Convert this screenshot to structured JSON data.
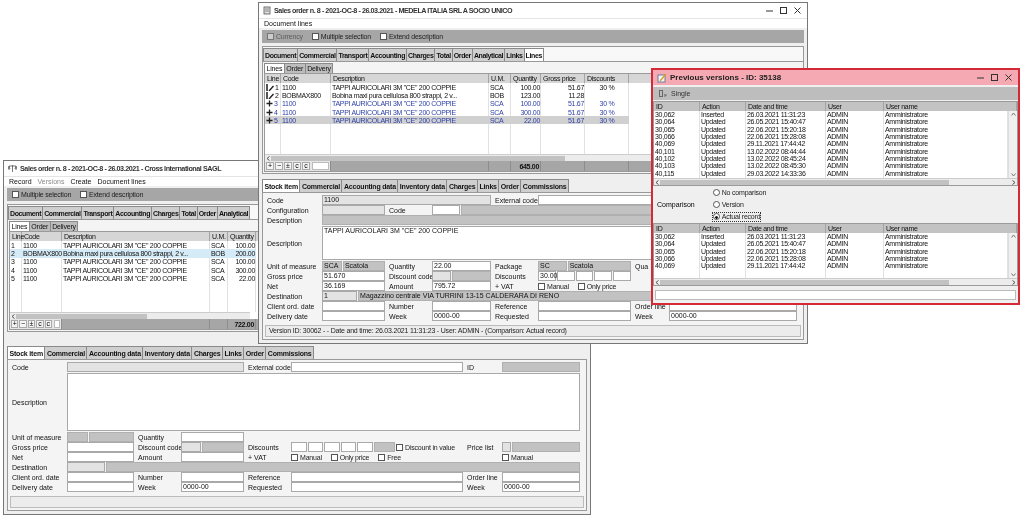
{
  "windows": [
    {
      "kind": "order",
      "title": "Sales order n. 8 - 2021-OC-8 - 26.03.2021 - Cross International SAGL",
      "menu": [
        {
          "label": "Record",
          "disabled": false
        },
        {
          "label": "Versions",
          "disabled": true
        },
        {
          "label": "Create",
          "disabled": false
        },
        {
          "label": "Document lines",
          "disabled": false
        }
      ],
      "options": [
        {
          "label": "Multiple selection",
          "checked": false,
          "disabled": false
        },
        {
          "label": "Extend description",
          "checked": false,
          "disabled": false
        }
      ],
      "tabs": [
        {
          "label": "Document",
          "selected": false
        },
        {
          "label": "Commercial",
          "selected": false
        },
        {
          "label": "Transport",
          "selected": false
        },
        {
          "label": "Accounting",
          "selected": false
        },
        {
          "label": "Charges",
          "selected": false
        },
        {
          "label": "Total",
          "selected": false
        },
        {
          "label": "Order",
          "selected": false
        },
        {
          "label": "Analytical",
          "selected": false
        }
      ],
      "subtabs": [
        {
          "label": "Lines",
          "selected": true
        },
        {
          "label": "Order",
          "selected": false
        },
        {
          "label": "Delivery",
          "selected": false
        }
      ],
      "grid": {
        "columns": [
          "Line",
          "Code",
          "Description",
          "U.M.",
          "Quantity"
        ],
        "rows": [
          {
            "kind": "plain",
            "selected": false,
            "cells": [
              "1",
              "1100",
              "TAPPI AURICOLARI 3M \"CE\" 200 COPPIE",
              "SCA",
              "100.00"
            ]
          },
          {
            "kind": "plain",
            "selected": true,
            "cells": [
              "2",
              "BOBMAX800",
              "Bobina maxi pura cellulosa 800 strappi, 2 v...",
              "BOB",
              "200.00"
            ]
          },
          {
            "kind": "plain",
            "selected": false,
            "cells": [
              "3",
              "1100",
              "TAPPI AURICOLARI 3M \"CE\" 200 COPPIE",
              "SCA",
              "100.00"
            ]
          },
          {
            "kind": "plain",
            "selected": false,
            "cells": [
              "4",
              "1100",
              "TAPPI AURICOLARI 3M \"CE\" 200 COPPIE",
              "SCA",
              "300.00"
            ]
          },
          {
            "kind": "plain",
            "selected": false,
            "cells": [
              "5",
              "1100",
              "TAPPI AURICOLARI 3M \"CE\" 200 COPPIE",
              "SCA",
              "22.00"
            ]
          }
        ],
        "buttons": [
          "+",
          "−",
          "±",
          "c",
          "c"
        ],
        "total": "722.00"
      },
      "detail_tabs": [
        {
          "label": "Stock item",
          "selected": true
        },
        {
          "label": "Commercial",
          "selected": false
        },
        {
          "label": "Accounting data",
          "selected": false
        },
        {
          "label": "Inventory data",
          "selected": false
        },
        {
          "label": "Charges",
          "selected": false
        },
        {
          "label": "Links",
          "selected": false
        },
        {
          "label": "Order",
          "selected": false
        },
        {
          "label": "Commissions",
          "selected": false
        }
      ],
      "form": [
        [
          {
            "label": "Code",
            "controls": [
              {
                "kind": "locked"
              }
            ]
          },
          {
            "label": "External code",
            "controls": [
              {
                "kind": "field"
              }
            ]
          },
          {
            "label": "ID",
            "controls": [
              {
                "kind": "readonly"
              }
            ]
          }
        ],
        [
          {
            "label": "Description",
            "controls": [
              {
                "kind": "memo"
              }
            ]
          }
        ],
        [
          {
            "label": "Unit of measure",
            "controls": [
              {
                "kind": "readonly"
              },
              {
                "kind": "readonly"
              }
            ]
          },
          {
            "label": "Quantity",
            "controls": [
              {
                "kind": "field"
              }
            ]
          }
        ],
        [
          {
            "label": "Gross price",
            "controls": [
              {
                "kind": "field"
              }
            ]
          },
          {
            "label": "Discount code",
            "controls": [
              {
                "kind": "locked"
              },
              {
                "kind": "readonly"
              }
            ]
          },
          {
            "label": "Discounts",
            "controls": [
              {
                "kind": "field"
              },
              {
                "kind": "field"
              },
              {
                "kind": "field"
              },
              {
                "kind": "field"
              },
              {
                "kind": "field"
              },
              {
                "kind": "readonly"
              },
              {
                "kind": "check",
                "label": "Discount in value",
                "checked": false
              }
            ]
          },
          {
            "label": "Price list",
            "controls": [
              {
                "kind": "locked"
              },
              {
                "kind": "readonly"
              }
            ]
          }
        ],
        [
          {
            "label": "Net",
            "controls": [
              {
                "kind": "field"
              }
            ]
          },
          {
            "label": "Amount",
            "controls": [
              {
                "kind": "field"
              }
            ]
          },
          {
            "label": "+ VAT",
            "controls": [
              {
                "kind": "check",
                "label": "Manual",
                "checked": false
              },
              {
                "kind": "check",
                "label": "Only price",
                "checked": false
              },
              {
                "kind": "check",
                "label": "Free",
                "checked": false
              }
            ]
          },
          {
            "controls": [
              {
                "kind": "check",
                "label": "Manual",
                "checked": false
              }
            ]
          }
        ],
        [
          {
            "label": "Destination",
            "controls": [
              {
                "kind": "locked"
              },
              {
                "kind": "readonly"
              }
            ]
          }
        ],
        [
          {
            "label": "Client ord. date",
            "controls": [
              {
                "kind": "field"
              }
            ]
          },
          {
            "label": "Number",
            "controls": [
              {
                "kind": "field"
              }
            ]
          },
          {
            "label": "Reference",
            "controls": [
              {
                "kind": "field"
              }
            ]
          },
          {
            "label": "Order line",
            "controls": [
              {
                "kind": "field"
              }
            ]
          }
        ],
        [
          {
            "label": "Delivery date",
            "controls": [
              {
                "kind": "field"
              }
            ]
          },
          {
            "label": "Week",
            "controls": [
              {
                "kind": "field",
                "value": "0000-00"
              }
            ]
          },
          {
            "label": "Requested",
            "controls": [
              {
                "kind": "field"
              }
            ]
          },
          {
            "label": "Week",
            "controls": [
              {
                "kind": "field",
                "value": "0000-00"
              }
            ]
          }
        ]
      ]
    },
    {
      "kind": "order",
      "title": "Sales order n. 8 - 2021-OC-8 - 26.03.2021 - MEDELA ITALIA SRL A SOCIO UNICO",
      "window_controls": true,
      "menu": [
        {
          "label": "Document lines",
          "disabled": false
        }
      ],
      "options": [
        {
          "label": "Currency",
          "checked": false,
          "disabled": true
        },
        {
          "label": "Multiple selection",
          "checked": false,
          "disabled": false
        },
        {
          "label": "Extend description",
          "checked": false,
          "disabled": false
        }
      ],
      "tabs": [
        {
          "label": "Document",
          "selected": false
        },
        {
          "label": "Commercial",
          "selected": false
        },
        {
          "label": "Transport",
          "selected": false
        },
        {
          "label": "Accounting",
          "selected": false
        },
        {
          "label": "Charges",
          "selected": false
        },
        {
          "label": "Total",
          "selected": false
        },
        {
          "label": "Order",
          "selected": false
        },
        {
          "label": "Analytical",
          "selected": false
        },
        {
          "label": "Links",
          "selected": false
        },
        {
          "label": "Lines",
          "selected": true
        }
      ],
      "subtabs": [
        {
          "label": "Lines",
          "selected": true
        },
        {
          "label": "Order",
          "selected": false
        },
        {
          "label": "Delivery",
          "selected": false
        }
      ],
      "grid": {
        "columns": [
          "Line",
          "Code",
          "Description",
          "U.M.",
          "Quantity",
          "Gross price",
          "Discounts"
        ],
        "rows": [
          {
            "kind": "saved",
            "selected": false,
            "cells": [
              "1",
              "1100",
              "TAPPI AURICOLARI 3M \"CE\" 200 COPPIE",
              "SCA",
              "100.00",
              "51.67",
              "30 %"
            ]
          },
          {
            "kind": "saved",
            "selected": false,
            "cells": [
              "2",
              "BOBMAX800",
              "Bobina maxi pura cellulosa 800 strappi, 2 v...",
              "BOB",
              "123.00",
              "11.28"
            ]
          },
          {
            "kind": "added",
            "selected": false,
            "cells": [
              "3",
              "1100",
              "TAPPI AURICOLARI 3M \"CE\" 200 COPPIE",
              "SCA",
              "100.00",
              "51.67",
              "30 %"
            ]
          },
          {
            "kind": "added",
            "selected": false,
            "cells": [
              "4",
              "1100",
              "TAPPI AURICOLARI 3M \"CE\" 200 COPPIE",
              "SCA",
              "300.00",
              "51.67",
              "30 %"
            ]
          },
          {
            "kind": "added",
            "selected": true,
            "cells": [
              "5",
              "1100",
              "TAPPI AURICOLARI 3M \"CE\" 200 COPPIE",
              "SCA",
              "22.00",
              "51.67",
              "30 %"
            ]
          }
        ],
        "buttons": [
          "+",
          "−",
          "±",
          "c",
          "c"
        ],
        "total": "645.00"
      },
      "detail_tabs": [
        {
          "label": "Stock item",
          "selected": true
        },
        {
          "label": "Commercial",
          "selected": false
        },
        {
          "label": "Accounting data",
          "selected": false
        },
        {
          "label": "Inventory data",
          "selected": false
        },
        {
          "label": "Charges",
          "selected": false
        },
        {
          "label": "Links",
          "selected": false
        },
        {
          "label": "Order",
          "selected": false
        },
        {
          "label": "Commissions",
          "selected": false
        }
      ],
      "form": [
        [
          {
            "label": "Code",
            "controls": [
              {
                "kind": "locked",
                "value": "1100"
              }
            ]
          },
          {
            "label": "External code",
            "controls": [
              {
                "kind": "field"
              }
            ]
          }
        ],
        [
          {
            "label": "Configuration",
            "controls": [
              {
                "kind": "locked"
              }
            ]
          },
          {
            "label": "Code",
            "controls": [
              {
                "kind": "field"
              },
              {
                "kind": "readonly"
              }
            ]
          }
        ],
        [
          {
            "label": "Description",
            "controls": [
              {
                "kind": "readonly"
              }
            ]
          }
        ],
        [
          {
            "label": "Description",
            "controls": [
              {
                "kind": "memo",
                "value": "TAPPI AURICOLARI 3M \"CE\" 200 COPPIE"
              }
            ]
          }
        ],
        [
          {
            "label": "Unit of measure",
            "controls": [
              {
                "kind": "readonly",
                "value": "SCA"
              },
              {
                "kind": "readonly",
                "value": "Scatola"
              }
            ]
          },
          {
            "label": "Quantity",
            "controls": [
              {
                "kind": "field",
                "value": "22.00"
              }
            ]
          },
          {
            "label": "Package",
            "controls": [
              {
                "kind": "readonly",
                "value": "SC"
              },
              {
                "kind": "readonly",
                "value": "Scatola"
              }
            ]
          },
          {
            "label": "Qua"
          }
        ],
        [
          {
            "label": "Gross price",
            "controls": [
              {
                "kind": "field",
                "value": "51.670"
              }
            ]
          },
          {
            "label": "Discount code",
            "controls": [
              {
                "kind": "locked"
              },
              {
                "kind": "readonly"
              }
            ]
          },
          {
            "label": "Discounts",
            "controls": [
              {
                "kind": "field",
                "value": "30.00"
              },
              {
                "kind": "field"
              },
              {
                "kind": "field"
              },
              {
                "kind": "field"
              },
              {
                "kind": "field"
              }
            ]
          }
        ],
        [
          {
            "label": "Net",
            "controls": [
              {
                "kind": "field",
                "value": "36.169"
              }
            ]
          },
          {
            "label": "Amount",
            "controls": [
              {
                "kind": "field",
                "value": "795.72"
              }
            ]
          },
          {
            "label": "+ VAT",
            "controls": [
              {
                "kind": "check",
                "label": "Manual",
                "checked": false
              },
              {
                "kind": "check",
                "label": "Only price",
                "checked": false
              }
            ]
          }
        ],
        [
          {
            "label": "Destination",
            "controls": [
              {
                "kind": "locked",
                "value": "1"
              },
              {
                "kind": "readonly",
                "value": "Magazzino centrale VIA TURRINI 13-15 CALDERARA DI RENO"
              }
            ]
          }
        ],
        [
          {
            "label": "Client ord. date",
            "controls": [
              {
                "kind": "field"
              }
            ]
          },
          {
            "label": "Number",
            "controls": [
              {
                "kind": "field"
              }
            ]
          },
          {
            "label": "Reference",
            "controls": [
              {
                "kind": "field"
              }
            ]
          },
          {
            "label": "Order line",
            "controls": [
              {
                "kind": "field"
              }
            ]
          }
        ],
        [
          {
            "label": "Delivery date",
            "controls": [
              {
                "kind": "field"
              }
            ]
          },
          {
            "label": "Week",
            "controls": [
              {
                "kind": "field",
                "value": "0000-00"
              }
            ]
          },
          {
            "label": "Requested",
            "controls": [
              {
                "kind": "field"
              }
            ]
          },
          {
            "label": "Week",
            "controls": [
              {
                "kind": "field",
                "value": "0000-00"
              }
            ]
          }
        ]
      ],
      "status": "Version ID: 30062 -  - Date and time: 26.03.2021 11:31:23 - User: ADMIN - (Comparison: Actual record)"
    },
    {
      "kind": "versions",
      "title": "Previous versions - ID: 35138",
      "window_controls": true,
      "toolbar": [
        "Single"
      ],
      "history": {
        "columns": [
          "ID",
          "Action",
          "Date and time",
          "User",
          "User name"
        ],
        "rows": [
          {
            "cells": [
              "30,062",
              "Inserted",
              "26.03.2021 11:31:23",
              "ADMIN",
              "Amministratore"
            ]
          },
          {
            "cells": [
              "30,064",
              "Updated",
              "26.05.2021 15:40:47",
              "ADMIN",
              "Amministratore"
            ]
          },
          {
            "cells": [
              "30,065",
              "Updated",
              "22.06.2021 15:20:18",
              "ADMIN",
              "Amministratore"
            ]
          },
          {
            "cells": [
              "30,066",
              "Updated",
              "22.06.2021 15:28:08",
              "ADMIN",
              "Amministratore"
            ]
          },
          {
            "cells": [
              "40,069",
              "Updated",
              "29.11.2021 17:44:42",
              "ADMIN",
              "Amministratore"
            ]
          },
          {
            "cells": [
              "40,101",
              "Updated",
              "13.02.2022 08:44:44",
              "ADMIN",
              "Amministratore"
            ]
          },
          {
            "cells": [
              "40,102",
              "Updated",
              "13.02.2022 08:45:24",
              "ADMIN",
              "Amministratore"
            ]
          },
          {
            "cells": [
              "40,103",
              "Updated",
              "13.02.2022 08:45:30",
              "ADMIN",
              "Amministratore"
            ]
          },
          {
            "cells": [
              "40,115",
              "Updated",
              "29.03.2022 14:33:36",
              "ADMIN",
              "Amministratore"
            ]
          }
        ]
      },
      "comparison": {
        "label": "Comparison",
        "options": [
          {
            "label": "No comparison",
            "selected": false
          },
          {
            "label": "Version",
            "selected": false
          },
          {
            "label": "Actual record",
            "selected": true
          }
        ]
      },
      "compare_list": {
        "columns": [
          "ID",
          "Action",
          "Date and time",
          "User",
          "User name"
        ],
        "rows": [
          {
            "cells": [
              "30,062",
              "Inserted",
              "26.03.2021 11:31:23",
              "ADMIN",
              "Amministratore"
            ]
          },
          {
            "cells": [
              "30,064",
              "Updated",
              "26.05.2021 15:40:47",
              "ADMIN",
              "Amministratore"
            ]
          },
          {
            "cells": [
              "30,065",
              "Updated",
              "22.06.2021 15:20:18",
              "ADMIN",
              "Amministratore"
            ]
          },
          {
            "cells": [
              "30,066",
              "Updated",
              "22.06.2021 15:28:08",
              "ADMIN",
              "Amministratore"
            ]
          },
          {
            "cells": [
              "40,069",
              "Updated",
              "29.11.2021 17:44:42",
              "ADMIN",
              "Amministratore"
            ]
          }
        ]
      }
    }
  ]
}
